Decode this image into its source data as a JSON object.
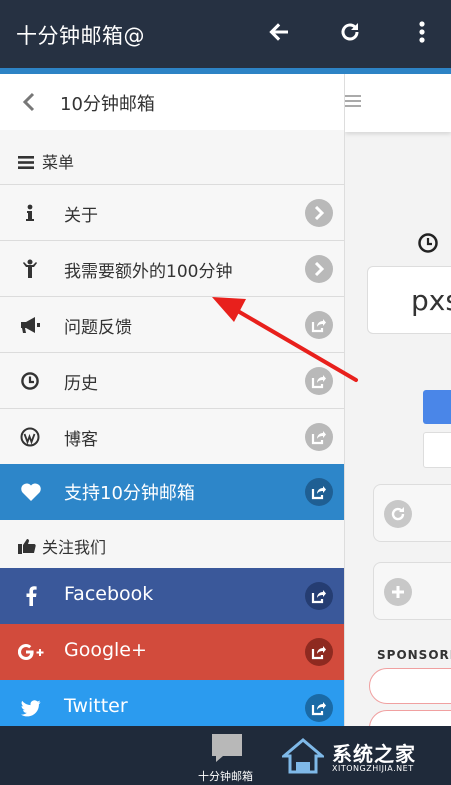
{
  "app_bar": {
    "title": "十分钟邮箱@"
  },
  "drawer": {
    "header_title": "10分钟邮箱",
    "menu_section_label": "菜单",
    "menu_items": [
      {
        "label": "关于",
        "icon": "info-icon",
        "action": "chevron-right-icon"
      },
      {
        "label": "我需要额外的100分钟",
        "icon": "person-icon",
        "action": "chevron-right-icon"
      },
      {
        "label": "问题反馈",
        "icon": "megaphone-icon",
        "action": "external-link-icon"
      },
      {
        "label": "历史",
        "icon": "clock-icon",
        "action": "external-link-icon"
      },
      {
        "label": "博客",
        "icon": "wordpress-icon",
        "action": "external-link-icon"
      }
    ],
    "support_item": {
      "label": "支持10分钟邮箱",
      "icon": "heart-icon",
      "color": "#2d86c9",
      "action_color": "#1f5f93"
    },
    "follow_section_label": "关注我们",
    "social_items": [
      {
        "label": "Facebook",
        "icon": "facebook-icon",
        "color": "#3a589a",
        "action_color": "#253d72"
      },
      {
        "label": "Google+",
        "icon": "google-plus-icon",
        "color": "#d24b3c",
        "action_color": "#8e2a20"
      },
      {
        "label": "Twitter",
        "icon": "twitter-icon",
        "color": "#2b9bef",
        "action_color": "#1a6aa6"
      }
    ]
  },
  "background_page": {
    "email_partial": "pxs",
    "sponsor_label": "SPONSORE"
  },
  "bottom_bar": {
    "label": "十分钟邮箱"
  },
  "watermark": {
    "text": "系统之家",
    "url": "XITONGZHIJIA.NET"
  }
}
